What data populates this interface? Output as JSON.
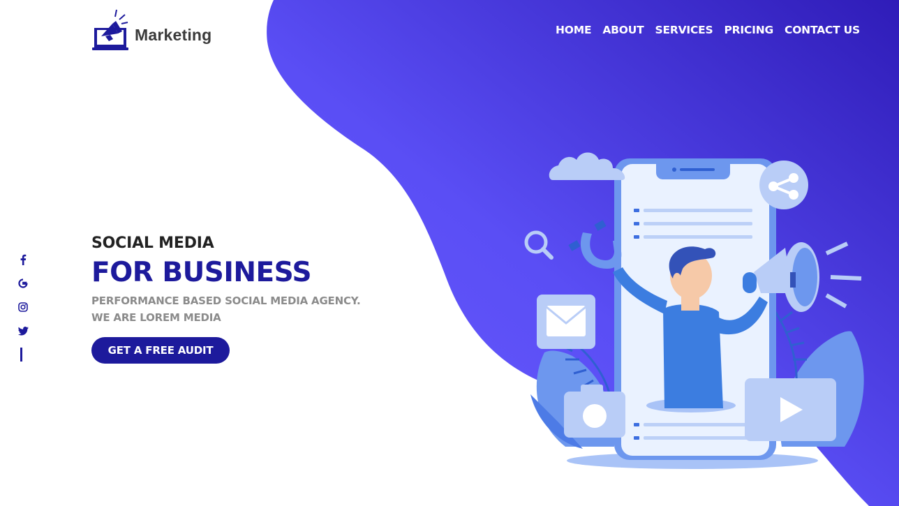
{
  "brand": {
    "name": "Marketing",
    "icon": "megaphone-laptop-icon"
  },
  "nav": {
    "items": [
      {
        "label": "HOME"
      },
      {
        "label": "ABOUT"
      },
      {
        "label": "SERVICES"
      },
      {
        "label": "PRICING"
      },
      {
        "label": "CONTACT US"
      }
    ]
  },
  "social": {
    "icons": [
      "facebook-icon",
      "google-icon",
      "instagram-icon",
      "twitter-icon"
    ]
  },
  "hero": {
    "kicker": "SOCIAL MEDIA",
    "headline": "FOR BUSINESS",
    "sub_line1": "PERFORMANCE BASED SOCIAL MEDIA AGENCY.",
    "sub_line2": "WE ARE LOREM MEDIA",
    "cta_label": "GET A FREE AUDIT"
  },
  "colors": {
    "accent": "#1d1a9c",
    "gradient_start": "#6257ff",
    "gradient_end": "#2f1db8",
    "nav_text": "#ffffff"
  }
}
